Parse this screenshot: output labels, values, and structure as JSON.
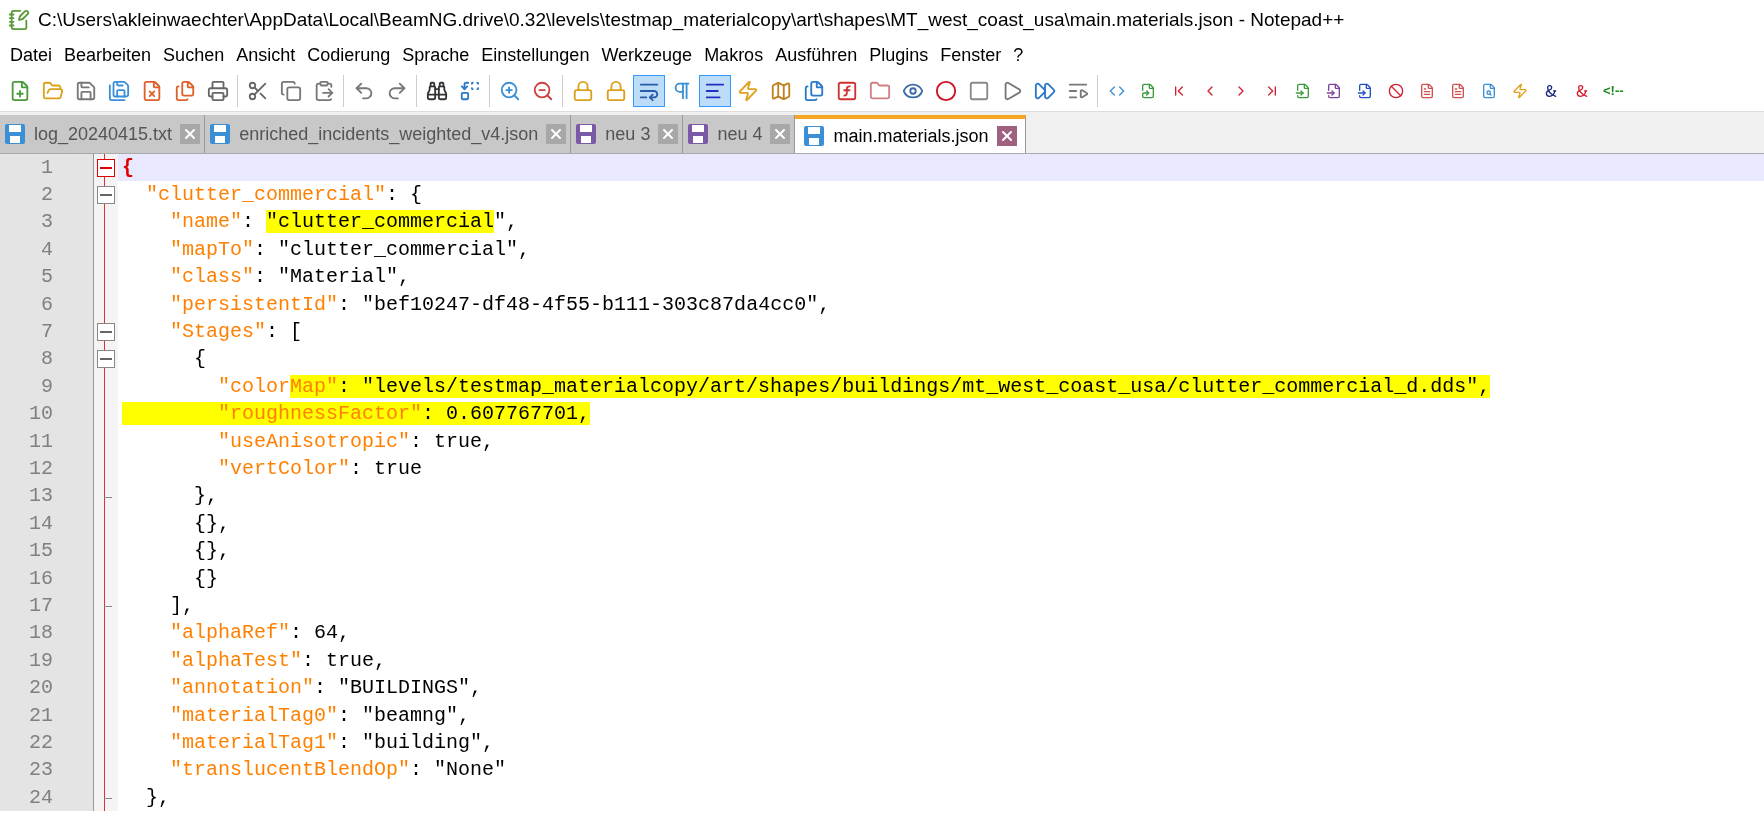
{
  "window": {
    "title": "C:\\Users\\akleinwaechter\\AppData\\Local\\BeamNG.drive\\0.32\\levels\\testmap_materialcopy\\art\\shapes\\MT_west_coast_usa\\main.materials.json - Notepad++"
  },
  "menu": [
    "Datei",
    "Bearbeiten",
    "Suchen",
    "Ansicht",
    "Codierung",
    "Sprache",
    "Einstellungen",
    "Werkzeuge",
    "Makros",
    "Ausführen",
    "Plugins",
    "Fenster",
    "?"
  ],
  "toolbar": [
    {
      "buttons": [
        {
          "kind": "new",
          "pressed": false
        },
        {
          "kind": "open",
          "pressed": false
        },
        {
          "kind": "save",
          "pressed": false
        },
        {
          "kind": "saveall",
          "pressed": false
        },
        {
          "kind": "close",
          "pressed": false
        },
        {
          "kind": "closeall",
          "pressed": false
        },
        {
          "kind": "print",
          "pressed": false
        }
      ]
    },
    {
      "buttons": [
        {
          "kind": "cut",
          "pressed": false
        },
        {
          "kind": "copy",
          "pressed": false
        },
        {
          "kind": "paste",
          "pressed": false
        }
      ]
    },
    {
      "buttons": [
        {
          "kind": "undo",
          "pressed": false
        },
        {
          "kind": "redo",
          "pressed": false
        }
      ]
    },
    {
      "buttons": [
        {
          "kind": "find",
          "pressed": false
        },
        {
          "kind": "replace",
          "pressed": false
        }
      ]
    },
    {
      "buttons": [
        {
          "kind": "zoomin",
          "pressed": false
        },
        {
          "kind": "zoomout",
          "pressed": false
        }
      ]
    },
    {
      "buttons": [
        {
          "kind": "lock",
          "pressed": false
        },
        {
          "kind": "lock",
          "pressed": false
        },
        {
          "kind": "wrap",
          "pressed": true
        },
        {
          "kind": "pilcrow",
          "pressed": false
        },
        {
          "kind": "indent",
          "pressed": true
        },
        {
          "kind": "zap",
          "pressed": false
        },
        {
          "kind": "map",
          "pressed": false
        },
        {
          "kind": "files",
          "pressed": false
        },
        {
          "kind": "function",
          "pressed": false
        },
        {
          "kind": "folder",
          "pressed": false
        },
        {
          "kind": "eye",
          "pressed": false
        },
        {
          "kind": "record",
          "pressed": false
        },
        {
          "kind": "stop",
          "pressed": false
        },
        {
          "kind": "play",
          "pressed": false
        },
        {
          "kind": "playmulti",
          "pressed": false
        },
        {
          "kind": "savemacro",
          "pressed": false
        }
      ]
    },
    {
      "buttons": [
        {
          "kind": "code",
          "pressed": false
        },
        {
          "kind": "filecheck",
          "pressed": false
        },
        {
          "kind": "first",
          "pressed": false
        },
        {
          "kind": "prev",
          "pressed": false
        },
        {
          "kind": "next",
          "pressed": false
        },
        {
          "kind": "last",
          "pressed": false
        },
        {
          "kind": "fileinput",
          "pressed": false
        },
        {
          "kind": "fileinput2",
          "pressed": false
        },
        {
          "kind": "fileinput3",
          "pressed": false
        },
        {
          "kind": "ban",
          "pressed": false
        },
        {
          "kind": "filetext",
          "pressed": false
        },
        {
          "kind": "filetext2",
          "pressed": false
        },
        {
          "kind": "filesearch",
          "pressed": false
        },
        {
          "kind": "zap2",
          "pressed": false
        },
        {
          "kind": "ampersand",
          "pressed": false
        },
        {
          "kind": "ampersand2",
          "pressed": false
        },
        {
          "kind": "comment",
          "pressed": false
        }
      ]
    }
  ],
  "comment_glyph": "<!--",
  "tabs": [
    {
      "label": "log_20240415.txt",
      "selected": false,
      "color": "#3a8fd6"
    },
    {
      "label": "enriched_incidents_weighted_v4.json",
      "selected": false,
      "color": "#3a8fd6"
    },
    {
      "label": "neu 3",
      "selected": false,
      "color": "#7a5aa8"
    },
    {
      "label": "neu 4",
      "selected": false,
      "color": "#7a5aa8"
    },
    {
      "label": "main.materials.json",
      "selected": true,
      "color": "#3a8fd6"
    }
  ],
  "editor": {
    "lines": [
      {
        "number": "1",
        "kind": "fold_start",
        "current": true,
        "segments": [
          {
            "kind": "brace",
            "text": "{",
            "highlighted": false
          }
        ]
      },
      {
        "number": "2",
        "kind": "fold_start",
        "current": false,
        "segments": [
          {
            "kind": "key",
            "text": "  \"clutter_commercial\"",
            "highlighted": false
          },
          {
            "kind": "punct",
            "text": ": {",
            "highlighted": false
          }
        ]
      },
      {
        "number": "3",
        "kind": "plain",
        "current": false,
        "segments": [
          {
            "kind": "key",
            "text": "    \"name\"",
            "highlighted": false
          },
          {
            "kind": "punct",
            "text": ": ",
            "highlighted": false
          },
          {
            "kind": "value",
            "text": "\"clutter_commercial",
            "highlighted": true
          },
          {
            "kind": "value",
            "text": "\",",
            "highlighted": false
          }
        ]
      },
      {
        "number": "4",
        "kind": "plain",
        "current": false,
        "segments": [
          {
            "kind": "key",
            "text": "    \"mapTo\"",
            "highlighted": false
          },
          {
            "kind": "punct",
            "text": ": ",
            "highlighted": false
          },
          {
            "kind": "value",
            "text": "\"clutter_commercial\",",
            "highlighted": false
          }
        ]
      },
      {
        "number": "5",
        "kind": "plain",
        "current": false,
        "segments": [
          {
            "kind": "key",
            "text": "    \"class\"",
            "highlighted": false
          },
          {
            "kind": "punct",
            "text": ": ",
            "highlighted": false
          },
          {
            "kind": "value",
            "text": "\"Material\",",
            "highlighted": false
          }
        ]
      },
      {
        "number": "6",
        "kind": "plain",
        "current": false,
        "segments": [
          {
            "kind": "key",
            "text": "    \"persistentId\"",
            "highlighted": false
          },
          {
            "kind": "punct",
            "text": ": ",
            "highlighted": false
          },
          {
            "kind": "value",
            "text": "\"bef10247-df48-4f55-b111-303c87da4cc0\",",
            "highlighted": false
          }
        ]
      },
      {
        "number": "7",
        "kind": "fold_start",
        "current": false,
        "segments": [
          {
            "kind": "key",
            "text": "    \"Stages\"",
            "highlighted": false
          },
          {
            "kind": "punct",
            "text": ": [",
            "highlighted": false
          }
        ]
      },
      {
        "number": "8",
        "kind": "fold_start",
        "current": false,
        "segments": [
          {
            "kind": "punct",
            "text": "      {",
            "highlighted": false
          }
        ]
      },
      {
        "number": "9",
        "kind": "plain",
        "current": false,
        "segments": [
          {
            "kind": "key",
            "text": "        \"color",
            "highlighted": false
          },
          {
            "kind": "key",
            "text": "Map\"",
            "highlighted": true
          },
          {
            "kind": "value",
            "text": ": \"levels/testmap_materialcopy/art/shapes/buildings/mt_west_coast_usa/clutter_commercial_d.dds\",",
            "highlighted": true
          }
        ]
      },
      {
        "number": "10",
        "kind": "plain",
        "current": false,
        "segments": [
          {
            "kind": "key",
            "text": "        \"roughnessFactor\"",
            "highlighted": true
          },
          {
            "kind": "value",
            "text": ": 0.607767701,",
            "highlighted": true
          }
        ]
      },
      {
        "number": "11",
        "kind": "plain",
        "current": false,
        "segments": [
          {
            "kind": "key",
            "text": "        \"useAnisotropic\"",
            "highlighted": false
          },
          {
            "kind": "value",
            "text": ": true,",
            "highlighted": false
          }
        ]
      },
      {
        "number": "12",
        "kind": "plain",
        "current": false,
        "segments": [
          {
            "kind": "key",
            "text": "        \"vertColor\"",
            "highlighted": false
          },
          {
            "kind": "value",
            "text": ": true",
            "highlighted": false
          }
        ]
      },
      {
        "number": "13",
        "kind": "fold_end",
        "current": false,
        "segments": [
          {
            "kind": "punct",
            "text": "      },",
            "highlighted": false
          }
        ]
      },
      {
        "number": "14",
        "kind": "plain",
        "current": false,
        "segments": [
          {
            "kind": "punct",
            "text": "      {},",
            "highlighted": false
          }
        ]
      },
      {
        "number": "15",
        "kind": "plain",
        "current": false,
        "segments": [
          {
            "kind": "punct",
            "text": "      {},",
            "highlighted": false
          }
        ]
      },
      {
        "number": "16",
        "kind": "plain",
        "current": false,
        "segments": [
          {
            "kind": "punct",
            "text": "      {}",
            "highlighted": false
          }
        ]
      },
      {
        "number": "17",
        "kind": "fold_end",
        "current": false,
        "segments": [
          {
            "kind": "punct",
            "text": "    ],",
            "highlighted": false
          }
        ]
      },
      {
        "number": "18",
        "kind": "plain",
        "current": false,
        "segments": [
          {
            "kind": "key",
            "text": "    \"alphaRef\"",
            "highlighted": false
          },
          {
            "kind": "value",
            "text": ": 64,",
            "highlighted": false
          }
        ]
      },
      {
        "number": "19",
        "kind": "plain",
        "current": false,
        "segments": [
          {
            "kind": "key",
            "text": "    \"alphaTest\"",
            "highlighted": false
          },
          {
            "kind": "value",
            "text": ": true,",
            "highlighted": false
          }
        ]
      },
      {
        "number": "20",
        "kind": "plain",
        "current": false,
        "segments": [
          {
            "kind": "key",
            "text": "    \"annotation\"",
            "highlighted": false
          },
          {
            "kind": "value",
            "text": ": \"BUILDINGS\",",
            "highlighted": false
          }
        ]
      },
      {
        "number": "21",
        "kind": "plain",
        "current": false,
        "segments": [
          {
            "kind": "key",
            "text": "    \"materialTag0\"",
            "highlighted": false
          },
          {
            "kind": "value",
            "text": ": \"beamng\",",
            "highlighted": false
          }
        ]
      },
      {
        "number": "22",
        "kind": "plain",
        "current": false,
        "segments": [
          {
            "kind": "key",
            "text": "    \"materialTag1\"",
            "highlighted": false
          },
          {
            "kind": "value",
            "text": ": \"building\",",
            "highlighted": false
          }
        ]
      },
      {
        "number": "23",
        "kind": "plain",
        "current": false,
        "segments": [
          {
            "kind": "key",
            "text": "    \"translucentBlendOp\"",
            "highlighted": false
          },
          {
            "kind": "value",
            "text": ": \"None\"",
            "highlighted": false
          }
        ]
      },
      {
        "number": "24",
        "kind": "fold_end",
        "current": false,
        "segments": [
          {
            "kind": "punct",
            "text": "  },",
            "highlighted": false
          }
        ]
      }
    ]
  }
}
